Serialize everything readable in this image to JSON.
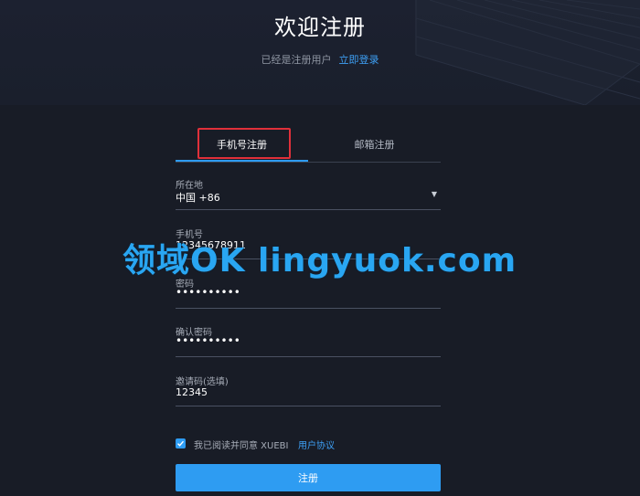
{
  "header": {
    "title": "欢迎注册",
    "subtitle": "已经是注册用户",
    "login_link": "立即登录"
  },
  "tabs": [
    {
      "label": "手机号注册",
      "active": true
    },
    {
      "label": "邮箱注册",
      "active": false
    }
  ],
  "form": {
    "region": {
      "label": "所在地",
      "value": "中国 +86"
    },
    "phone": {
      "label": "手机号",
      "value": "12345678911"
    },
    "password": {
      "label": "密码",
      "value": "••••••••••"
    },
    "confirm_password": {
      "label": "确认密码",
      "value": "••••••••••"
    },
    "invite_code": {
      "label": "邀请码(选填)",
      "value": "12345"
    }
  },
  "agreement": {
    "checked": true,
    "text": "我已阅读并同意 XUEBI",
    "link": "用户协议"
  },
  "submit_label": "注册",
  "watermark": "领域OK lingyuok.com",
  "colors": {
    "accent": "#2e9cf2",
    "link": "#3ea0f5",
    "background": "#181c26",
    "highlight_box": "#e0303a"
  },
  "icons": {
    "region_dropdown": "caret-down-icon",
    "agree_checkbox": "check-icon"
  }
}
